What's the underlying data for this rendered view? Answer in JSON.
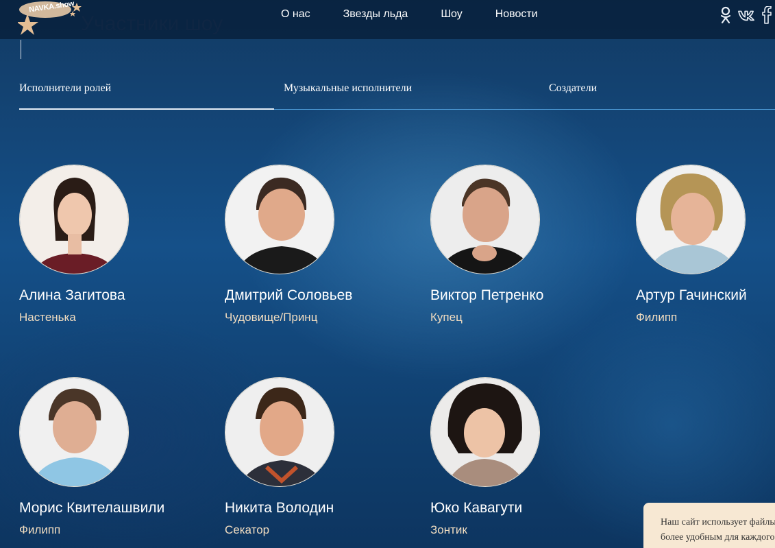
{
  "header": {
    "logo_text": "NAVKA.show",
    "page_title": "Участники шоу",
    "nav": [
      {
        "label": "О нас"
      },
      {
        "label": "Звезды льда"
      },
      {
        "label": "Шоу"
      },
      {
        "label": "Новости"
      }
    ],
    "social": [
      "odnoklassniki-icon",
      "vk-icon",
      "facebook-icon"
    ]
  },
  "tabs": [
    {
      "label": "Исполнители ролей",
      "active": true
    },
    {
      "label": "Музыкальные исполнители",
      "active": false
    },
    {
      "label": "Создатели",
      "active": false
    }
  ],
  "people": [
    {
      "name": "Алина Загитова",
      "role": "Настенька"
    },
    {
      "name": "Дмитрий Соловьев",
      "role": "Чудовище/Принц"
    },
    {
      "name": "Виктор Петренко",
      "role": "Купец"
    },
    {
      "name": "Артур Гачинский",
      "role": "Филипп"
    },
    {
      "name": "Морис Квителашвили",
      "role": "Филипп"
    },
    {
      "name": "Никита Володин",
      "role": "Секатор"
    },
    {
      "name": "Юко Кавагути",
      "role": "Зонтик"
    }
  ],
  "cookie": {
    "line1": "Наш сайт использует файлы cookie",
    "line2": "более удобным для каждого"
  },
  "colors": {
    "accent_role": "#f0dcc0",
    "tab_underline": "#4d9ad6",
    "cookie_bg": "#f7e8d3"
  }
}
